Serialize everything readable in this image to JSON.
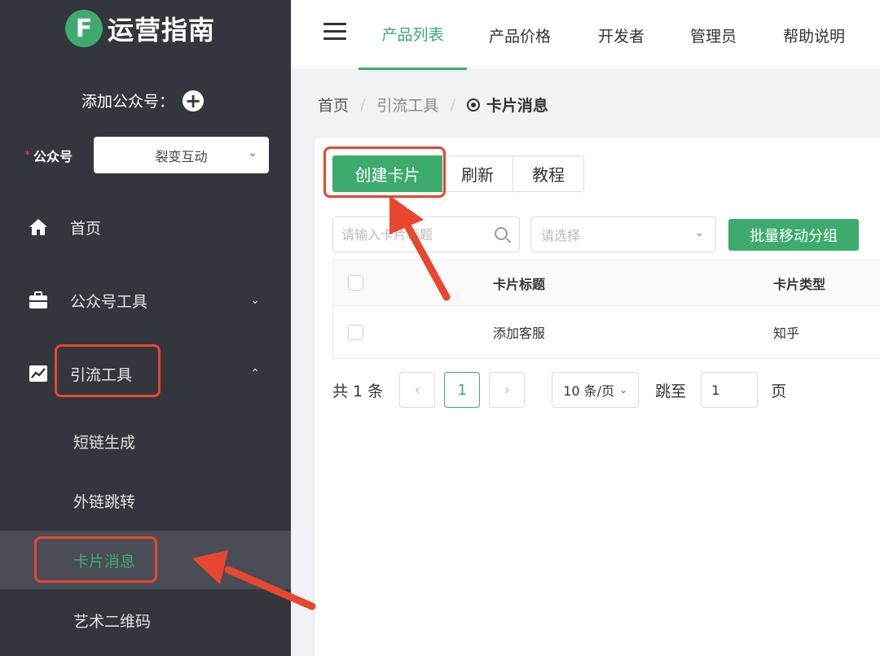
{
  "sidebar": {
    "logo_mark": "F",
    "logo_text": "运营指南",
    "add_account_label": "添加公众号：",
    "account_label": "公众号",
    "account_required": "*",
    "account_value": "裂变互动",
    "nav": {
      "home": "首页",
      "account_tools": "公众号工具",
      "traffic_tools": "引流工具"
    },
    "sub_items": {
      "short_link": "短链生成",
      "external_link": "外链跳转",
      "card_message": "卡片消息",
      "art_qrcode": "艺术二维码"
    }
  },
  "header": {
    "tabs": [
      "产品列表",
      "产品价格",
      "开发者",
      "管理员",
      "帮助说明"
    ],
    "active_tab": "产品列表"
  },
  "breadcrumb": {
    "home": "首页",
    "parent": "引流工具",
    "current": "卡片消息"
  },
  "toolbar": {
    "create_label": "创建卡片",
    "refresh_label": "刷新",
    "tutorial_label": "教程"
  },
  "filters": {
    "search_placeholder": "请输入卡片标题",
    "select_placeholder": "请选择",
    "batch_move_label": "批量移动分组"
  },
  "table": {
    "columns": [
      "卡片标题",
      "卡片类型"
    ],
    "rows": [
      {
        "title": "添加客服",
        "type": "知乎"
      }
    ]
  },
  "pagination": {
    "total_text": "共 1 条",
    "current_page": "1",
    "page_size": "10 条/页",
    "jump_label": "跳至",
    "jump_value": "1",
    "page_suffix": "页"
  },
  "colors": {
    "accent": "#3dab6d",
    "sidebar_bg": "#33363d",
    "highlight": "#e8462f"
  }
}
